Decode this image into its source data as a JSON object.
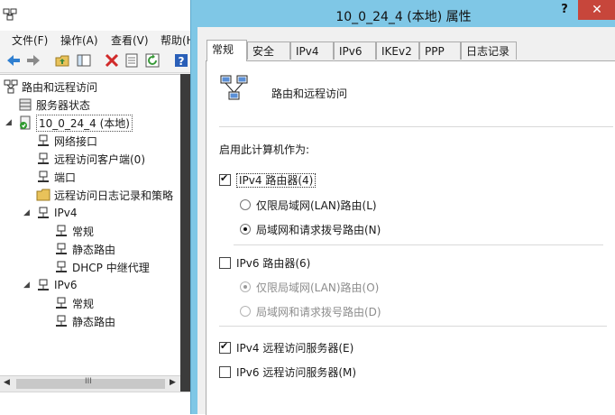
{
  "bg_window": {
    "menu": [
      "文件(F)",
      "操作(A)",
      "查看(V)",
      "帮助(H"
    ],
    "tree": {
      "root": "路由和远程访问",
      "server_status": "服务器状态",
      "server": "10_0_24_4 (本地)",
      "network_interfaces": "网络接口",
      "remote_clients": "远程访问客户端(0)",
      "ports": "端口",
      "logging_policy": "远程访问日志记录和策略",
      "ipv4": "IPv4",
      "ipv4_general": "常规",
      "ipv4_static_routes": "静态路由",
      "dhcp_relay": "DHCP 中继代理",
      "ipv6": "IPv6",
      "ipv6_general": "常规",
      "ipv6_static_routes": "静态路由"
    },
    "hscroll_thumb": "III"
  },
  "dialog": {
    "title": "10_0_24_4 (本地) 属性",
    "help": "?",
    "close": "✕",
    "tabs": [
      "常规",
      "安全",
      "IPv4",
      "IPv6",
      "IKEv2",
      "PPP",
      "日志记录"
    ],
    "active_tab": "常规",
    "panel_title": "路由和远程访问",
    "enable_as": "启用此计算机作为:",
    "ipv4_router": {
      "label": "IPv4 路由器(4)",
      "checked": true
    },
    "ipv4_lan_only": {
      "label": "仅限局域网(LAN)路由(L)",
      "checked": false
    },
    "ipv4_lan_demand": {
      "label": "局域网和请求拨号路由(N)",
      "checked": true
    },
    "ipv6_router": {
      "label": "IPv6 路由器(6)",
      "checked": false
    },
    "ipv6_lan_only": {
      "label": "仅限局域网(LAN)路由(O)",
      "checked": true,
      "disabled": true
    },
    "ipv6_lan_demand": {
      "label": "局域网和请求拨号路由(D)",
      "checked": false,
      "disabled": true
    },
    "ipv4_ras": {
      "label": "IPv4 远程访问服务器(E)",
      "checked": true
    },
    "ipv6_ras": {
      "label": "IPv6 远程访问服务器(M)",
      "checked": false
    }
  },
  "colors": {
    "dialog_frame": "#7fc7e6",
    "close_button": "#c7463b",
    "tab_border": "#acacac"
  }
}
